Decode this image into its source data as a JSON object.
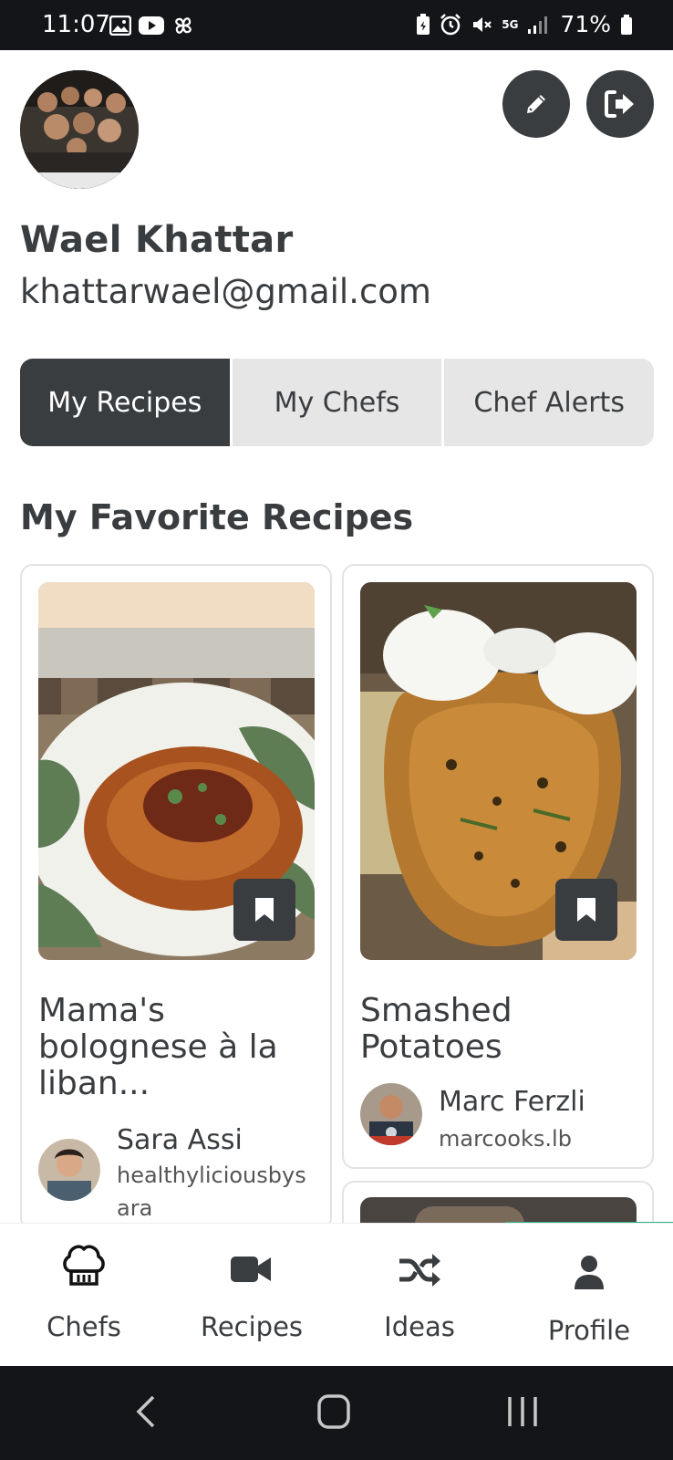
{
  "status_bar": {
    "time": "11:07",
    "battery": "71%",
    "network": "5G"
  },
  "profile": {
    "name": "Wael Khattar",
    "email": "khattarwael@gmail.com"
  },
  "tabs": [
    {
      "label": "My Recipes",
      "active": true
    },
    {
      "label": "My Chefs",
      "active": false
    },
    {
      "label": "Chef Alerts",
      "active": false
    }
  ],
  "section_title": "My Favorite Recipes",
  "recipes": [
    {
      "title": "Mama's bolognese à la liban...",
      "chef_name": "Sara Assi",
      "chef_handle": "healthyliciousbysara"
    },
    {
      "title": "Smashed Potatoes",
      "chef_name": "Marc Ferzli",
      "chef_handle": "marcooks.lb"
    }
  ],
  "bottom_nav": [
    {
      "label": "Chefs",
      "icon": "chef-hat-icon"
    },
    {
      "label": "Recipes",
      "icon": "video-camera-icon"
    },
    {
      "label": "Ideas",
      "icon": "shuffle-icon"
    },
    {
      "label": "Profile",
      "icon": "user-icon"
    }
  ],
  "colors": {
    "dark": "#393d40",
    "tab_inactive": "#e6e6e6",
    "accent": "#2db383",
    "status_bar": "#141519"
  }
}
